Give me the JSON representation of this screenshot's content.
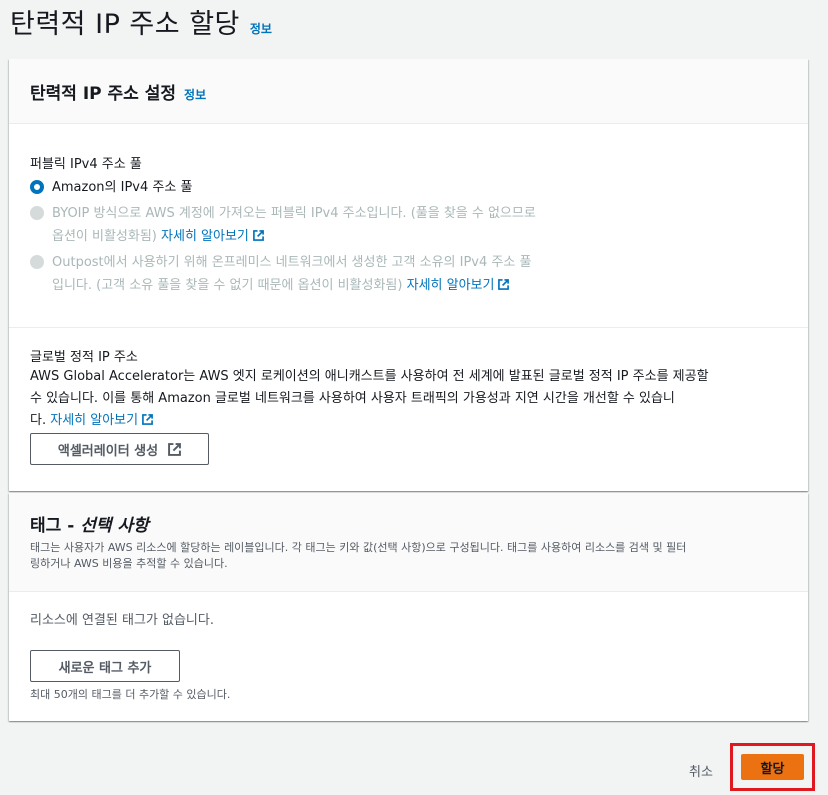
{
  "page": {
    "title": "탄력적 IP 주소 할당",
    "info": "정보"
  },
  "settings": {
    "title": "탄력적 IP 주소 설정",
    "info": "정보",
    "pool_label": "퍼블릭 IPv4 주소 풀",
    "options": [
      {
        "label": "Amazon의 IPv4 주소 풀",
        "selected": true,
        "disabled": false
      },
      {
        "label_line1": "BYOIP 방식으로 AWS 계정에 가져오는 퍼블릭 IPv4 주소입니다. (풀을 찾을 수 없으므로",
        "label_line2": "옵션이 비활성화됨)",
        "link": "자세히 알아보기",
        "selected": false,
        "disabled": true
      },
      {
        "label_line1": "Outpost에서 사용하기 위해 온프레미스 네트워크에서 생성한 고객 소유의 IPv4 주소 풀",
        "label_line2": "입니다. (고객 소유 풀을 찾을 수 없기 때문에 옵션이 비활성화됨)",
        "link": "자세히 알아보기",
        "selected": false,
        "disabled": true
      }
    ],
    "global_label": "글로벌 정적 IP 주소",
    "global_desc_line1": "AWS Global Accelerator는 AWS 엣지 로케이션의 애니캐스트를 사용하여 전 세계에 발표된 글로벌 정적 IP 주소를 제공할",
    "global_desc_line2": "수 있습니다. 이를 통해 Amazon 글로벌 네트워크를 사용하여 사용자 트래픽의 가용성과 지연 시간을 개선할 수 있습니",
    "global_desc_line3": "다.",
    "global_link": "자세히 알아보기",
    "accelerator_button": "액셀러레이터 생성"
  },
  "tags": {
    "title_main": "태그 - ",
    "title_optional": "선택 사항",
    "desc_line1": "태그는 사용자가 AWS 리소스에 할당하는 레이블입니다. 각 태그는 키와 값(선택 사항)으로 구성됩니다. 태그를 사용하여 리소스를 검색 및 필터",
    "desc_line2": "링하거나 AWS 비용을 추적할 수 있습니다.",
    "empty": "리소스에 연결된 태그가 없습니다.",
    "add_button": "새로운 태그 추가",
    "hint": "최대 50개의 태그를 더 추가할 수 있습니다."
  },
  "footer": {
    "cancel": "취소",
    "assign": "할당"
  },
  "colors": {
    "link": "#0073bb",
    "primary": "#ec7211",
    "highlight": "#e0181f"
  }
}
